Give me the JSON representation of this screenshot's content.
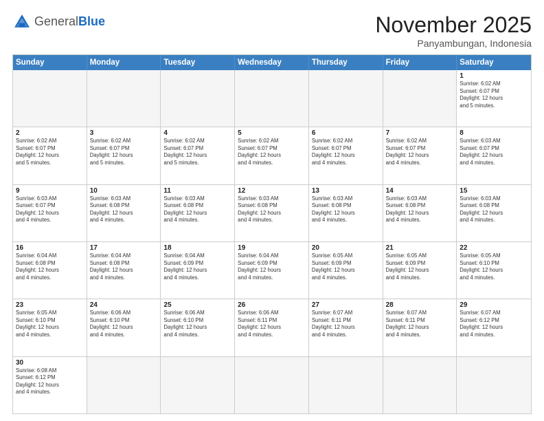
{
  "logo": {
    "general": "General",
    "blue": "Blue"
  },
  "title": "November 2025",
  "location": "Panyambungan, Indonesia",
  "header_days": [
    "Sunday",
    "Monday",
    "Tuesday",
    "Wednesday",
    "Thursday",
    "Friday",
    "Saturday"
  ],
  "weeks": [
    [
      {
        "day": "",
        "info": ""
      },
      {
        "day": "",
        "info": ""
      },
      {
        "day": "",
        "info": ""
      },
      {
        "day": "",
        "info": ""
      },
      {
        "day": "",
        "info": ""
      },
      {
        "day": "",
        "info": ""
      },
      {
        "day": "1",
        "info": "Sunrise: 6:02 AM\nSunset: 6:07 PM\nDaylight: 12 hours\nand 5 minutes."
      }
    ],
    [
      {
        "day": "2",
        "info": "Sunrise: 6:02 AM\nSunset: 6:07 PM\nDaylight: 12 hours\nand 5 minutes."
      },
      {
        "day": "3",
        "info": "Sunrise: 6:02 AM\nSunset: 6:07 PM\nDaylight: 12 hours\nand 5 minutes."
      },
      {
        "day": "4",
        "info": "Sunrise: 6:02 AM\nSunset: 6:07 PM\nDaylight: 12 hours\nand 5 minutes."
      },
      {
        "day": "5",
        "info": "Sunrise: 6:02 AM\nSunset: 6:07 PM\nDaylight: 12 hours\nand 4 minutes."
      },
      {
        "day": "6",
        "info": "Sunrise: 6:02 AM\nSunset: 6:07 PM\nDaylight: 12 hours\nand 4 minutes."
      },
      {
        "day": "7",
        "info": "Sunrise: 6:02 AM\nSunset: 6:07 PM\nDaylight: 12 hours\nand 4 minutes."
      },
      {
        "day": "8",
        "info": "Sunrise: 6:03 AM\nSunset: 6:07 PM\nDaylight: 12 hours\nand 4 minutes."
      }
    ],
    [
      {
        "day": "9",
        "info": "Sunrise: 6:03 AM\nSunset: 6:07 PM\nDaylight: 12 hours\nand 4 minutes."
      },
      {
        "day": "10",
        "info": "Sunrise: 6:03 AM\nSunset: 6:08 PM\nDaylight: 12 hours\nand 4 minutes."
      },
      {
        "day": "11",
        "info": "Sunrise: 6:03 AM\nSunset: 6:08 PM\nDaylight: 12 hours\nand 4 minutes."
      },
      {
        "day": "12",
        "info": "Sunrise: 6:03 AM\nSunset: 6:08 PM\nDaylight: 12 hours\nand 4 minutes."
      },
      {
        "day": "13",
        "info": "Sunrise: 6:03 AM\nSunset: 6:08 PM\nDaylight: 12 hours\nand 4 minutes."
      },
      {
        "day": "14",
        "info": "Sunrise: 6:03 AM\nSunset: 6:08 PM\nDaylight: 12 hours\nand 4 minutes."
      },
      {
        "day": "15",
        "info": "Sunrise: 6:03 AM\nSunset: 6:08 PM\nDaylight: 12 hours\nand 4 minutes."
      }
    ],
    [
      {
        "day": "16",
        "info": "Sunrise: 6:04 AM\nSunset: 6:08 PM\nDaylight: 12 hours\nand 4 minutes."
      },
      {
        "day": "17",
        "info": "Sunrise: 6:04 AM\nSunset: 6:08 PM\nDaylight: 12 hours\nand 4 minutes."
      },
      {
        "day": "18",
        "info": "Sunrise: 6:04 AM\nSunset: 6:09 PM\nDaylight: 12 hours\nand 4 minutes."
      },
      {
        "day": "19",
        "info": "Sunrise: 6:04 AM\nSunset: 6:09 PM\nDaylight: 12 hours\nand 4 minutes."
      },
      {
        "day": "20",
        "info": "Sunrise: 6:05 AM\nSunset: 6:09 PM\nDaylight: 12 hours\nand 4 minutes."
      },
      {
        "day": "21",
        "info": "Sunrise: 6:05 AM\nSunset: 6:09 PM\nDaylight: 12 hours\nand 4 minutes."
      },
      {
        "day": "22",
        "info": "Sunrise: 6:05 AM\nSunset: 6:10 PM\nDaylight: 12 hours\nand 4 minutes."
      }
    ],
    [
      {
        "day": "23",
        "info": "Sunrise: 6:05 AM\nSunset: 6:10 PM\nDaylight: 12 hours\nand 4 minutes."
      },
      {
        "day": "24",
        "info": "Sunrise: 6:06 AM\nSunset: 6:10 PM\nDaylight: 12 hours\nand 4 minutes."
      },
      {
        "day": "25",
        "info": "Sunrise: 6:06 AM\nSunset: 6:10 PM\nDaylight: 12 hours\nand 4 minutes."
      },
      {
        "day": "26",
        "info": "Sunrise: 6:06 AM\nSunset: 6:11 PM\nDaylight: 12 hours\nand 4 minutes."
      },
      {
        "day": "27",
        "info": "Sunrise: 6:07 AM\nSunset: 6:11 PM\nDaylight: 12 hours\nand 4 minutes."
      },
      {
        "day": "28",
        "info": "Sunrise: 6:07 AM\nSunset: 6:11 PM\nDaylight: 12 hours\nand 4 minutes."
      },
      {
        "day": "29",
        "info": "Sunrise: 6:07 AM\nSunset: 6:12 PM\nDaylight: 12 hours\nand 4 minutes."
      }
    ],
    [
      {
        "day": "30",
        "info": "Sunrise: 6:08 AM\nSunset: 6:12 PM\nDaylight: 12 hours\nand 4 minutes."
      },
      {
        "day": "",
        "info": ""
      },
      {
        "day": "",
        "info": ""
      },
      {
        "day": "",
        "info": ""
      },
      {
        "day": "",
        "info": ""
      },
      {
        "day": "",
        "info": ""
      },
      {
        "day": "",
        "info": ""
      }
    ]
  ]
}
